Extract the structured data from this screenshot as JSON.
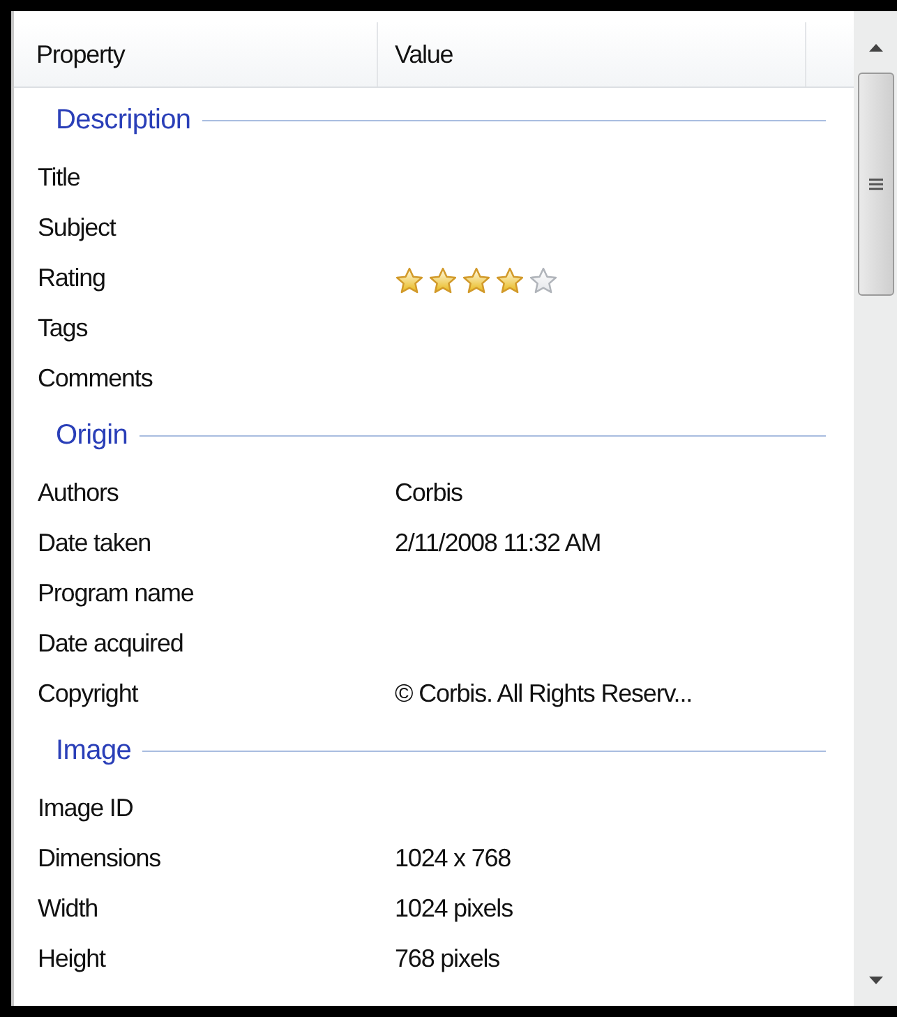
{
  "columns": [
    "Property",
    "Value"
  ],
  "groups": [
    {
      "name": "Description",
      "rows": [
        {
          "property": "Title"
        },
        {
          "property": "Subject"
        },
        {
          "property": "Rating",
          "kind": "stars",
          "stars": 4
        },
        {
          "property": "Tags"
        },
        {
          "property": "Comments"
        }
      ]
    },
    {
      "name": "Origin",
      "rows": [
        {
          "property": "Authors",
          "value": "Corbis"
        },
        {
          "property": "Date taken",
          "value": "2/11/2008 11:32 AM"
        },
        {
          "property": "Program name"
        },
        {
          "property": "Date acquired"
        },
        {
          "property": "Copyright",
          "value": "© Corbis.  All Rights Reserv..."
        }
      ]
    },
    {
      "name": "Image",
      "rows": [
        {
          "property": "Image ID"
        },
        {
          "property": "Dimensions",
          "value": "1024 x 768"
        },
        {
          "property": "Width",
          "value": "1024 pixels"
        },
        {
          "property": "Height",
          "value": "768 pixels"
        }
      ]
    }
  ]
}
